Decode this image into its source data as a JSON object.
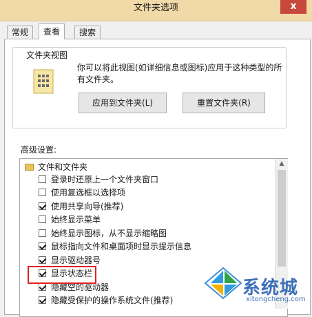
{
  "window": {
    "title": "文件夹选项",
    "close_glyph": "x"
  },
  "tabs": [
    {
      "label": "常规",
      "active": false
    },
    {
      "label": "查看",
      "active": true
    },
    {
      "label": "搜索",
      "active": false
    }
  ],
  "folder_view": {
    "legend": "文件夹视图",
    "description": "你可以将此视图(如详细信息或图标)应用于这种类型的所有文件夹。",
    "apply_button": "应用到文件夹(L)",
    "reset_button": "重置文件夹(R)"
  },
  "advanced": {
    "label": "高级设置:",
    "folder_label": "文件和文件夹",
    "items": [
      {
        "label": "登录时还原上一个文件夹窗口",
        "checked": false
      },
      {
        "label": "使用复选框以选择项",
        "checked": false
      },
      {
        "label": "使用共享向导(推荐)",
        "checked": true
      },
      {
        "label": "始终显示菜单",
        "checked": false
      },
      {
        "label": "始终显示图标，从不显示缩略图",
        "checked": false
      },
      {
        "label": "鼠标指向文件和桌面项时显示提示信息",
        "checked": true
      },
      {
        "label": "显示驱动器号",
        "checked": true
      },
      {
        "label": "显示状态栏",
        "checked": true
      },
      {
        "label": "隐藏空的驱动器",
        "checked": true
      },
      {
        "label": "隐藏受保护的操作系统文件(推荐)",
        "checked": true
      }
    ]
  },
  "watermark": {
    "name": "系统城",
    "url": "xitongcheng.com"
  }
}
